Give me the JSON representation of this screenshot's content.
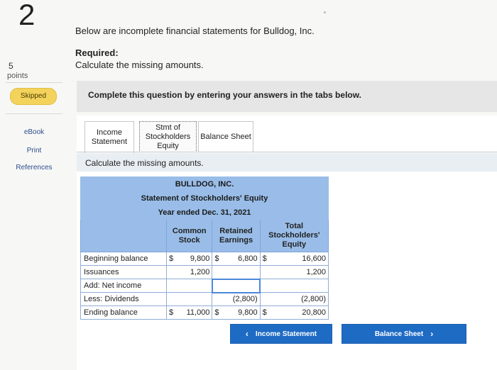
{
  "question": {
    "number": "2",
    "points_value": "5",
    "points_label": "points",
    "status": "Skipped"
  },
  "rail": {
    "ebook": "eBook",
    "print": "Print",
    "references": "References"
  },
  "intro": "Below are incomplete financial statements for Bulldog, Inc.",
  "required": {
    "title": "Required:",
    "text": "Calculate the missing amounts."
  },
  "instructions": "Complete this question by entering your answers in the tabs below.",
  "tabs": [
    {
      "label_1": "Income",
      "label_2": "Statement"
    },
    {
      "label_1": "Stmt of",
      "label_2": "Stockholders",
      "label_3": "Equity",
      "active": true
    },
    {
      "label_1": "Balance Sheet"
    }
  ],
  "tab_prompt": "Calculate the missing amounts.",
  "statement": {
    "company": "BULLDOG, INC.",
    "title": "Statement of Stockholders' Equity",
    "period": "Year ended Dec. 31, 2021",
    "columns": {
      "common_1": "Common",
      "common_2": "Stock",
      "retained_1": "Retained",
      "retained_2": "Earnings",
      "total_1": "Total",
      "total_2": "Stockholders'",
      "total_3": "Equity"
    },
    "rows": [
      {
        "label": "Beginning balance",
        "cs_cur": "$",
        "cs": "9,800",
        "re_cur": "$",
        "re": "6,800",
        "tot_cur": "$",
        "tot": "16,600"
      },
      {
        "label": "Issuances",
        "cs_cur": "",
        "cs": "1,200",
        "re_cur": "",
        "re": "",
        "tot_cur": "",
        "tot": "1,200"
      },
      {
        "label": "Add: Net income",
        "cs_cur": "",
        "cs": "",
        "re_cur": "",
        "re": "",
        "tot_cur": "",
        "tot": ""
      },
      {
        "label": "Less: Dividends",
        "cs_cur": "",
        "cs": "",
        "re_cur": "",
        "re": "(2,800)",
        "tot_cur": "",
        "tot": "(2,800)"
      },
      {
        "label": "Ending balance",
        "cs_cur": "$",
        "cs": "11,000",
        "re_cur": "$",
        "re": "9,800",
        "tot_cur": "$",
        "tot": "20,800"
      }
    ]
  },
  "nav": {
    "prev_label": "Income Statement",
    "prev_icon": "chevron-left-icon",
    "next_label": "Balance Sheet",
    "next_icon": "chevron-right-icon"
  },
  "colors": {
    "table_header": "#99bde8",
    "skipped_badge": "#f3d35c",
    "nav_button": "#1e6bc4"
  }
}
